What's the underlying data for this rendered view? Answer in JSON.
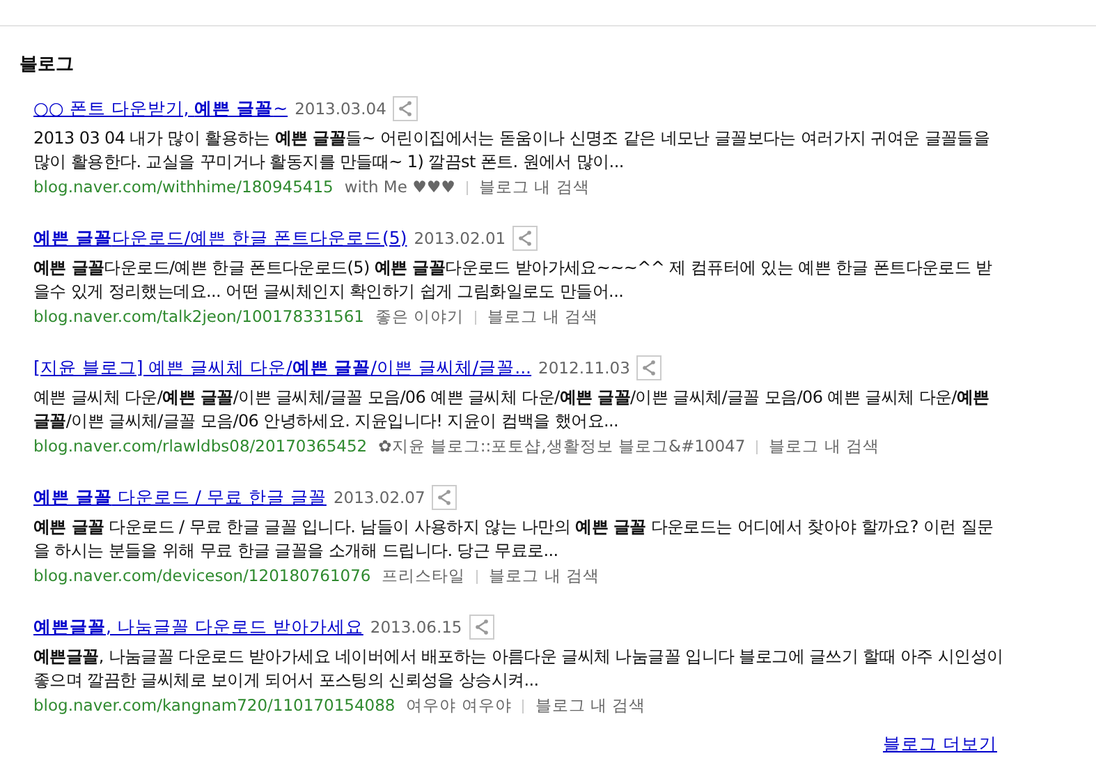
{
  "section": {
    "title": "블로그",
    "items": [
      {
        "title": "○○ 폰트 다운받기, **예쁜 글꼴**~",
        "date": "2013.03.04",
        "body": "2013 03 04 내가 많이 활용하는 **예쁜 글꼴**들~ 어린이집에서는 돋움이나 신명조 같은 네모난 글꼴보다는 여러가지 귀여운 글꼴들을 많이 활용한다. 교실을 꾸미거나 활동지를 만들때~ 1) 깔끔st 폰트. 원에서 많이...",
        "url": "blog.naver.com/withhime/180945415",
        "author": "with Me ♥♥♥",
        "search_link": "블로그 내 검색"
      },
      {
        "title": "**예쁜 글꼴**다운로드/예쁜 한글 폰트다운로드(5)",
        "date": "2013.02.01",
        "body": "**예쁜 글꼴**다운로드/예쁜 한글 폰트다운로드(5) **예쁜 글꼴**다운로드 받아가세요~~~^^ 제 컴퓨터에 있는 예쁜 한글 폰트다운로드 받을수 있게 정리했는데요... 어떤 글씨체인지 확인하기 쉽게 그림화일로도 만들어...",
        "url": "blog.naver.com/talk2jeon/100178331561",
        "author": "좋은 이야기",
        "search_link": "블로그 내 검색"
      },
      {
        "title": "[지윤 블로그] 예쁜 글씨체 다운/**예쁜 글꼴**/이쁜 글씨체/글꼴...",
        "date": "2012.11.03",
        "body": "예쁜 글씨체 다운/**예쁜 글꼴**/이쁜 글씨체/글꼴 모음/06 예쁜 글씨체 다운/**예쁜 글꼴**/이쁜 글씨체/글꼴 모음/06 예쁜 글씨체 다운/**예쁜 글꼴**/이쁜 글씨체/글꼴 모음/06 안녕하세요. 지윤입니다! 지윤이 컴백을 했어요...",
        "url": "blog.naver.com/rlawldbs08/20170365452",
        "author": "✿지윤 블로그::포토샵,생활정보 블로그&#10047",
        "search_link": "블로그 내 검색"
      },
      {
        "title": "**예쁜 글꼴** 다운로드 / 무료 한글 글꼴",
        "date": "2013.02.07",
        "body": "**예쁜 글꼴** 다운로드 / 무료 한글 글꼴 입니다. 남들이 사용하지 않는 나만의 **예쁜 글꼴** 다운로드는 어디에서 찾아야 할까요? 이런 질문을 하시는 분들을 위해 무료 한글 글꼴을 소개해 드립니다. 당근 무료로...",
        "url": "blog.naver.com/deviceson/120180761076",
        "author": "프리스타일",
        "search_link": "블로그 내 검색"
      },
      {
        "title": "**예쁜글꼴**, 나눔글꼴 다운로드 받아가세요",
        "date": "2013.06.15",
        "body": "**예쁜글꼴**, 나눔글꼴 다운로드 받아가세요 네이버에서 배포하는 아름다운 글씨체 나눔글꼴 입니다 블로그에 글쓰기 할때 아주 시인성이 좋으며 깔끔한 글씨체로 보이게 되어서 포스팅의 신뢰성을 상승시켜...",
        "url": "blog.naver.com/kangnam720/110170154088",
        "author": "여우야 여우야",
        "search_link": "블로그 내 검색"
      }
    ],
    "more_link": "블로그 더보기"
  }
}
